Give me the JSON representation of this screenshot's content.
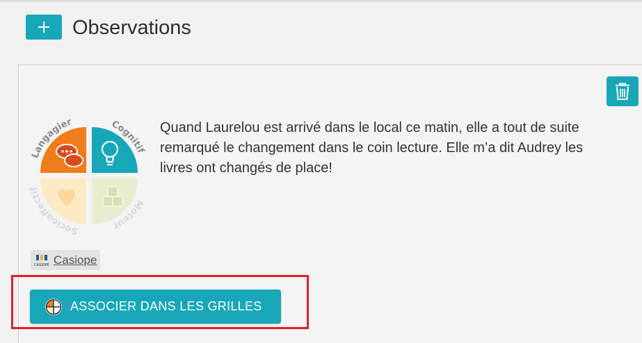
{
  "header": {
    "title": "Observations",
    "add_icon": "plus-icon"
  },
  "observation": {
    "text": "Quand Laurelou est arrivé dans le local ce matin, elle a tout de suite remarqué le changement dans le coin lecture. Elle m’a dit Audrey les livres ont changés de place!",
    "delete_icon": "trash-icon",
    "domains": {
      "top_left": {
        "label": "Langagier",
        "color": "#f07c1b"
      },
      "top_right": {
        "label": "Cognitif",
        "color": "#17a7b8"
      },
      "bottom_left": {
        "label": "Socioaffectif",
        "color": "#fdebc8"
      },
      "bottom_right": {
        "label": "Moteur",
        "color": "#e6eecf"
      }
    },
    "source": {
      "name": "Casiope",
      "logo_text": "CASIOPE"
    }
  },
  "actions": {
    "associate_label": "ASSOCIER DANS LES GRILLES",
    "associate_icon": "grid-wheel-icon"
  },
  "colors": {
    "accent": "#17a7b8",
    "highlight": "#e0202c"
  }
}
